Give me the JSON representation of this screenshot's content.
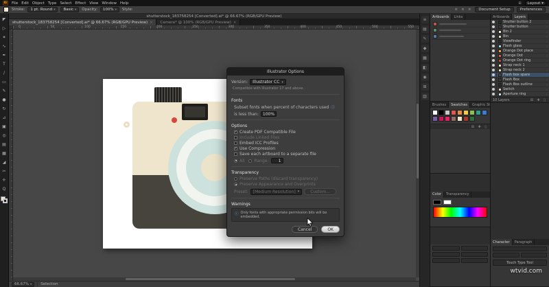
{
  "menubar": {
    "app_icon": "Ai",
    "items": [
      "File",
      "Edit",
      "Object",
      "Type",
      "Select",
      "Effect",
      "View",
      "Window",
      "Help"
    ],
    "workspace": "Layout",
    "caret": "▾"
  },
  "controlbar": {
    "stroke_label": "Stroke:",
    "stroke_value": "1 pt. Round",
    "brush_value": "Basic",
    "opacity_label": "Opacity:",
    "opacity_value": "100%",
    "style_label": "Style:",
    "doc_setup": "Document Setup",
    "preferences": "Preferences",
    "align_icons": "≡ ≡ ≡"
  },
  "titlebar": {
    "text": "shutterstock_183758254 [Converted].ai* @ 66.67% (RGB/GPU Preview)"
  },
  "tabs": [
    {
      "label": "shutterstock_183758254 [Converted].ai* @ 66.67% (RGB/GPU Preview)",
      "active": true
    },
    {
      "label": "Camera* @ 100% (RGB/GPU Preview)",
      "active": false
    }
  ],
  "ruler_numbers": [
    "0",
    "50",
    "100",
    "150",
    "200",
    "250",
    "300",
    "350",
    "400",
    "450",
    "500",
    "550"
  ],
  "tools": [
    {
      "name": "selection-tool",
      "glyph": "◤"
    },
    {
      "name": "direct-selection-tool",
      "glyph": "▷"
    },
    {
      "name": "magic-wand-tool",
      "glyph": "✶"
    },
    {
      "name": "lasso-tool",
      "glyph": "∿"
    },
    {
      "name": "pen-tool",
      "glyph": "✒"
    },
    {
      "name": "type-tool",
      "glyph": "T"
    },
    {
      "name": "line-segment-tool",
      "glyph": "/"
    },
    {
      "name": "rectangle-tool",
      "glyph": "▭"
    },
    {
      "name": "pencil-tool",
      "glyph": "✎"
    },
    {
      "name": "blob-brush-tool",
      "glyph": "●"
    },
    {
      "name": "rotate-tool",
      "glyph": "↻"
    },
    {
      "name": "scale-tool",
      "glyph": "⊿"
    },
    {
      "name": "free-transform-tool",
      "glyph": "▣"
    },
    {
      "name": "shape-builder-tool",
      "glyph": "◎"
    },
    {
      "name": "gradient-tool",
      "glyph": "▤"
    },
    {
      "name": "mesh-tool",
      "glyph": "▦"
    },
    {
      "name": "eyedropper-tool",
      "glyph": "◢"
    },
    {
      "name": "scissors-tool",
      "glyph": "✂"
    },
    {
      "name": "hand-tool",
      "glyph": "✛"
    },
    {
      "name": "zoom-tool",
      "glyph": "Q"
    }
  ],
  "dock_icons": [
    {
      "name": "stroke-panel-icon",
      "glyph": "≡"
    },
    {
      "name": "swatches-panel-icon",
      "glyph": "▤"
    },
    {
      "name": "brushes-panel-icon",
      "glyph": "✎"
    },
    {
      "name": "symbols-panel-icon",
      "glyph": "◆"
    },
    {
      "name": "color-panel-icon",
      "glyph": "▦"
    },
    {
      "name": "transparency-panel-icon",
      "glyph": "◧"
    },
    {
      "name": "appearance-panel-icon",
      "glyph": "◉"
    },
    {
      "name": "links-panel-icon",
      "glyph": "⊞"
    },
    {
      "name": "gradient-panel-icon",
      "glyph": "▥"
    }
  ],
  "dialog": {
    "title": "Illustrator Options",
    "version_label": "Version:",
    "version_value": "Illustrator CC",
    "compat_note": "Compatible with Illustrator 17 and above.",
    "fonts_header": "Fonts",
    "subset_line1": "Subset fonts when percent of characters used",
    "subset_line2": "is less than:",
    "subset_value": "100%",
    "options_header": "Options",
    "options": [
      {
        "label": "Create PDF Compatible File",
        "checked": true,
        "enabled": true
      },
      {
        "label": "Include Linked Files",
        "checked": false,
        "enabled": false
      },
      {
        "label": "Embed ICC Profiles",
        "checked": false,
        "enabled": true
      },
      {
        "label": "Use Compression",
        "checked": true,
        "enabled": true
      },
      {
        "label": "Save each artboard to a separate file",
        "checked": false,
        "enabled": true
      }
    ],
    "artboard_radios": [
      {
        "label": "All",
        "selected": true,
        "value": ""
      },
      {
        "label": "Range:",
        "selected": false,
        "value": "1"
      }
    ],
    "transparency_header": "Transparency",
    "transparency_radios": [
      {
        "label": "Preserve Paths (discard transparency)",
        "selected": false
      },
      {
        "label": "Preserve Appearance and Overprints",
        "selected": true
      }
    ],
    "preset_label": "Preset:",
    "preset_value": "[Medium Resolution]",
    "custom_button": "Custom...",
    "warnings_header": "Warnings",
    "warning_text": "Only fonts with appropriate permission bits will be embedded.",
    "cancel": "Cancel",
    "ok": "OK"
  },
  "panels": {
    "a1": {
      "tabs": [
        "Artboards",
        "Links"
      ],
      "active": "Artboards"
    },
    "swatches": {
      "tabs": [
        "Brushes",
        "Swatches",
        "Graphic Styles"
      ],
      "active": "Swatches",
      "colors": [
        "#ffffff",
        "#000000",
        "#c8c8c8",
        "#e2574c",
        "#e8883d",
        "#f2c94c",
        "#8bc34a",
        "#2e9e8f",
        "#3a7bd5",
        "#7b5ea7",
        "#c2185b",
        "#e91e63",
        "#8d6e63",
        "#efe4ca",
        "#a33a2e",
        "#2e6e3a"
      ]
    },
    "color": {
      "tabs": [
        "Color",
        "Transparency"
      ],
      "active": "Color"
    },
    "layers": {
      "tabs": [
        "Artboards",
        "Layers"
      ],
      "active": "Layers",
      "items": [
        {
          "name": "Shutter button 2",
          "color": "#2b2b2b",
          "selected": false
        },
        {
          "name": "Shutter button",
          "color": "#3a3a3a",
          "selected": false
        },
        {
          "name": "Bin 2",
          "color": "#f0e6cf",
          "selected": false
        },
        {
          "name": "Bin",
          "color": "#e8dcc0",
          "selected": false
        },
        {
          "name": "Viewfinder",
          "color": "#2f2f2f",
          "selected": false
        },
        {
          "name": "Flash glass",
          "color": "#9fd8d8",
          "selected": false
        },
        {
          "name": "Orange Dot place",
          "color": "#e8a33d",
          "selected": false
        },
        {
          "name": "Orange Dot",
          "color": "#e2574c",
          "selected": false
        },
        {
          "name": "Orange Dot ring",
          "color": "#c9463a",
          "selected": false
        },
        {
          "name": "Strap neck 1",
          "color": "#efe4ca",
          "selected": false
        },
        {
          "name": "Strap neck 2",
          "color": "#e6d9ba",
          "selected": false
        },
        {
          "name": "Flash box spare",
          "color": "#4a4843",
          "selected": true
        },
        {
          "name": "Flash Box",
          "color": "#3f3d38",
          "selected": false
        },
        {
          "name": "Flash Box outline",
          "color": "#2e2c28",
          "selected": false
        },
        {
          "name": "Switch",
          "color": "#d8d3c4",
          "selected": false
        },
        {
          "name": "Aperture ring",
          "color": "#cfe5e2",
          "selected": false
        }
      ],
      "footer": "10 Layers",
      "footer_icons": "⊞ ✚ ▯"
    },
    "character": {
      "tabs": [
        "Character",
        "Paragraph"
      ],
      "active": "Character",
      "touch_type": "Touch Type Tool"
    }
  },
  "status": {
    "zoom": "66.67%",
    "label": "Selection"
  },
  "watermark": "wtvid.com"
}
